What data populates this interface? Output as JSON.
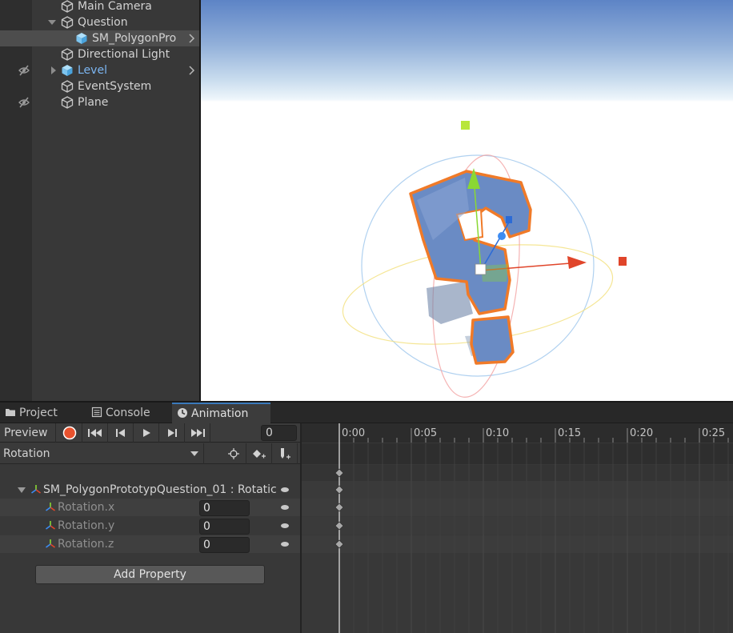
{
  "hierarchy": {
    "items": [
      {
        "label": "Main Camera",
        "icon": "cube-outline-icon",
        "indent": 1
      },
      {
        "label": "Question",
        "icon": "cube-outline-icon",
        "indent": 1,
        "expanded": true
      },
      {
        "label": "SM_PolygonPro",
        "icon": "cube-solid-icon",
        "indent": 2,
        "selected": true,
        "has_children": true
      },
      {
        "label": "Directional Light",
        "icon": "cube-outline-icon",
        "indent": 1
      },
      {
        "label": "Level",
        "icon": "prefab-icon",
        "indent": 1,
        "prefab": true,
        "hidden": true,
        "collapsed": true
      },
      {
        "label": "EventSystem",
        "icon": "cube-outline-icon",
        "indent": 1
      },
      {
        "label": "Plane",
        "icon": "cube-outline-icon",
        "indent": 1,
        "hidden": true
      }
    ]
  },
  "scene": {
    "sky_color": "#5d84c6",
    "ground_color": "#ffffff",
    "object_color": "#6a8bc4",
    "outline_color": "#f07a28",
    "gizmo_x_color": "#e0452a",
    "gizmo_y_color": "#8ad833",
    "gizmo_z_color": "#2c6bd6"
  },
  "tabs": [
    {
      "label": "Project",
      "icon": "folder-icon"
    },
    {
      "label": "Console",
      "icon": "console-icon"
    },
    {
      "label": "Animation",
      "icon": "clock-icon",
      "active": true
    }
  ],
  "animation": {
    "preview_label": "Preview",
    "frame_value": "0",
    "clip_name": "Rotation",
    "object_path": "SM_PolygonPrototypQuestion_01 : Rotatic",
    "properties": [
      {
        "label": "Rotation.x",
        "value": "0"
      },
      {
        "label": "Rotation.y",
        "value": "0"
      },
      {
        "label": "Rotation.z",
        "value": "0"
      }
    ],
    "add_property_label": "Add Property",
    "timeline_ticks": [
      "0:00",
      "0:05",
      "0:10",
      "0:15",
      "0:20",
      "0:25"
    ],
    "record_color": "#e8522e"
  }
}
